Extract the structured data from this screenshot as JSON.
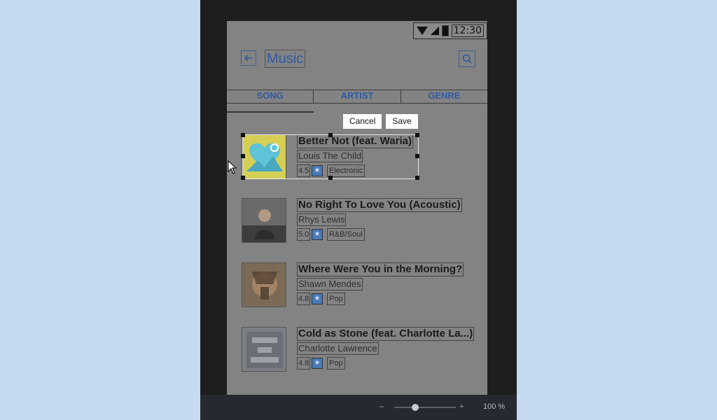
{
  "status_bar": {
    "time": "12:30"
  },
  "header": {
    "title": "Music"
  },
  "tabs": [
    {
      "label": "SONG"
    },
    {
      "label": "ARTIST"
    },
    {
      "label": "GENRE"
    }
  ],
  "edit_actions": {
    "cancel": "Cancel",
    "save": "Save"
  },
  "songs": [
    {
      "title": "Better Not (feat. Waria)",
      "artist": "Louis The Child",
      "rating": "4.5",
      "genre": "Electronic"
    },
    {
      "title": "No Right To Love You (Acoustic)",
      "artist": "Rhys Lewis",
      "rating": "5.0",
      "genre": "R&B/Soul"
    },
    {
      "title": "Where Were You in the Morning?",
      "artist": "Shawn Mendes",
      "rating": "4.8",
      "genre": "Pop"
    },
    {
      "title": "Cold as Stone (feat. Charlotte La...)",
      "artist": "Charlotte Lawrence",
      "rating": "4.8",
      "genre": "Pop"
    }
  ],
  "zoom": {
    "minus": "–",
    "plus": "+",
    "level": "100 %"
  },
  "colors": {
    "accent": "#2f5aa0",
    "background": "#c5daf0",
    "editor": "#1e1e1e",
    "phone_overlay": "#838383"
  }
}
